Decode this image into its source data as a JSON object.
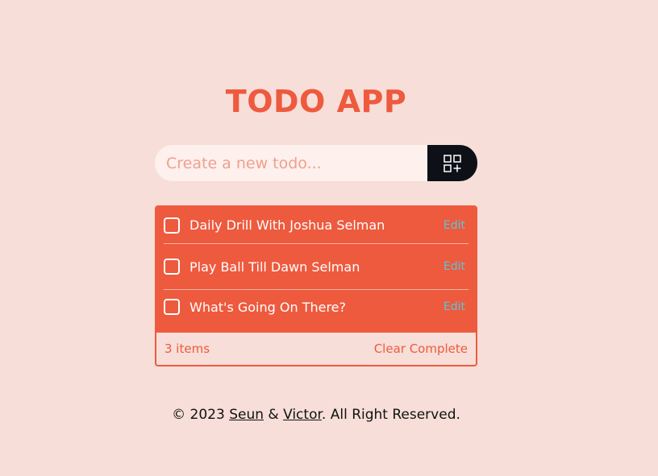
{
  "app": {
    "title": "TODO APP"
  },
  "new_todo": {
    "placeholder": "Create a new todo...",
    "value": "",
    "add_icon": "grid-plus-icon"
  },
  "todos": [
    {
      "text": "Daily Drill With Joshua Selman",
      "edit_label": "Edit",
      "checked": false
    },
    {
      "text": "Play Ball Till Dawn Selman",
      "edit_label": "Edit",
      "checked": false
    },
    {
      "text": "What's Going On There?",
      "edit_label": "Edit",
      "checked": false
    }
  ],
  "list_footer": {
    "count_label": "3 items",
    "clear_label": "Clear Complete"
  },
  "footer": {
    "prefix": "© 2023 ",
    "author1": "Seun",
    "separator": " & ",
    "author2": "Victor",
    "suffix": ". All Right Reserved."
  },
  "colors": {
    "background": "#f7ded8",
    "accent": "#ee5a3e",
    "edit": "#5ec4d6",
    "button": "#0d1117"
  }
}
